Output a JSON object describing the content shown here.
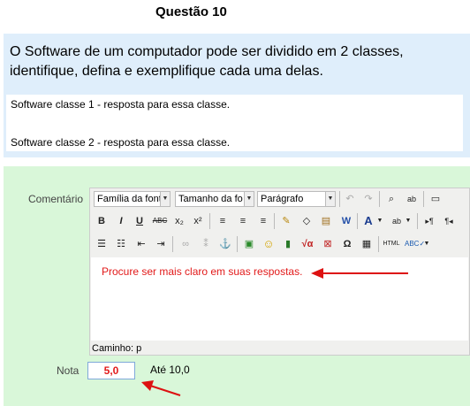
{
  "question": {
    "title": "Questão 10",
    "text": "O Software de um computador pode ser dividido em 2 classes, identifique, defina e exemplifique cada uma delas."
  },
  "answers": [
    "Software classe 1 - resposta para essa classe.",
    "Software classe 2 - resposta para essa classe."
  ],
  "grading": {
    "comment_label": "Comentário",
    "font_family_select": "Família da font",
    "font_size_select": "Tamanho da fo",
    "format_select": "Parágrafo",
    "editor_content": "Procure ser mais claro em suas respostas.",
    "path_label": "Caminho: p",
    "grade_label": "Nota",
    "grade_value": "5,0",
    "max_label": "Até  10,0"
  },
  "toolbar_icons": [
    "undo-icon",
    "redo-icon",
    "find-icon",
    "replace-icon",
    "fullscreen-icon",
    "bold-icon",
    "italic-icon",
    "underline-icon",
    "strikethrough-icon",
    "subscript-icon",
    "superscript-icon",
    "align-left-icon",
    "align-center-icon",
    "align-right-icon",
    "cleanup-icon",
    "eraser-icon",
    "paste-text-icon",
    "paste-word-icon",
    "text-color-icon",
    "highlight-color-icon",
    "ltr-icon",
    "rtl-icon",
    "bullet-list-icon",
    "numbered-list-icon",
    "outdent-icon",
    "indent-icon",
    "link-icon",
    "unlink-icon",
    "anchor-icon",
    "image-icon",
    "emoticon-icon",
    "media-icon",
    "math-icon",
    "nolink-icon",
    "special-char-icon",
    "table-icon",
    "html-icon",
    "spellcheck-icon"
  ],
  "colors": {
    "question_bg": "#dfeefb",
    "grading_bg": "#d9f7d9",
    "annotation_arrow": "#d11"
  }
}
